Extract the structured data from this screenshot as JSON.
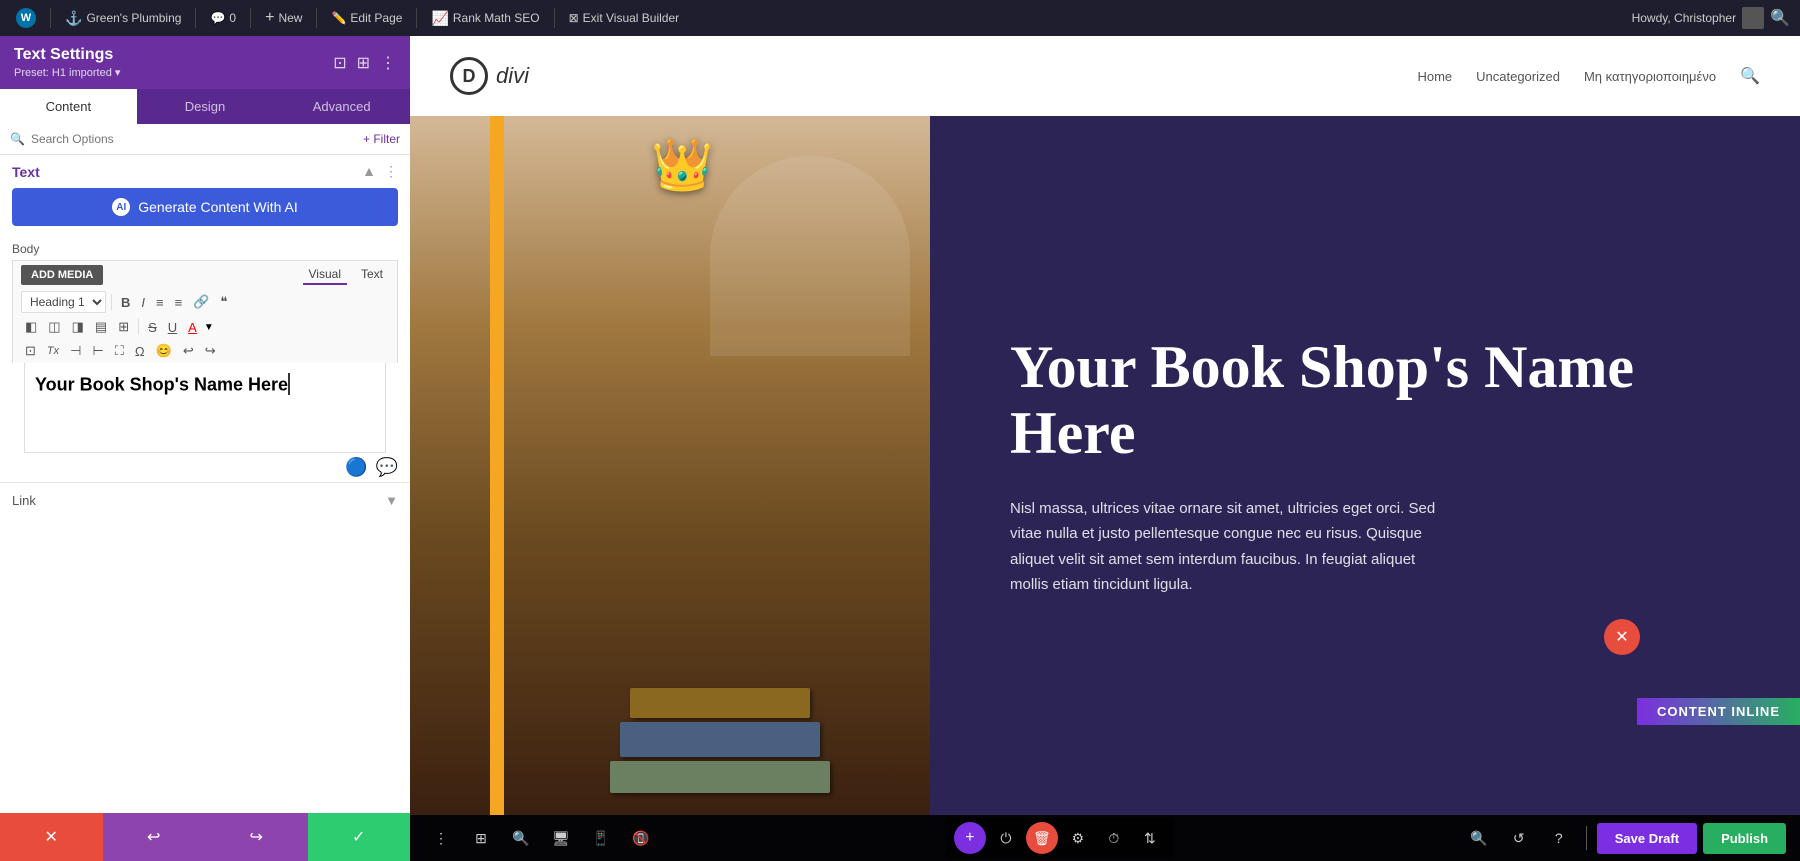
{
  "topbar": {
    "wp_icon": "W",
    "site_name": "Green's Plumbing",
    "comments_count": "0",
    "new_label": "New",
    "edit_page_label": "Edit Page",
    "rank_math_label": "Rank Math SEO",
    "exit_label": "Exit Visual Builder",
    "howdy_label": "Howdy, Christopher"
  },
  "panel": {
    "title": "Text Settings",
    "preset": "Preset: H1 imported ▾",
    "tabs": [
      "Content",
      "Design",
      "Advanced"
    ],
    "active_tab": "Content",
    "search_placeholder": "Search Options",
    "filter_label": "+ Filter",
    "section_title": "Text",
    "ai_button_label": "Generate Content With AI",
    "body_label": "Body",
    "add_media_label": "ADD MEDIA",
    "editor_tab_visual": "Visual",
    "editor_tab_text": "Text",
    "heading_option": "Heading 1",
    "text_content": "Your Book Shop's Name Here",
    "link_label": "Link",
    "bottom_actions": {
      "cancel": "✕",
      "undo": "↩",
      "redo": "↪",
      "confirm": "✓"
    }
  },
  "site": {
    "logo_letter": "D",
    "logo_name": "divi",
    "nav_links": [
      "Home",
      "Uncategorized",
      "Μη κατηγοριοποιημένο"
    ],
    "hero_title": "Your Book Shop's Name Here",
    "hero_body": "Nisl massa, ultrices vitae ornare sit amet, ultricies eget orci. Sed vitae nulla et justo pellentesque congue nec eu risus. Quisque aliquet velit sit amet sem interdum faucibus. In feugiat aliquet mollis etiam tincidunt ligula."
  },
  "builder": {
    "save_draft_label": "Save Draft",
    "publish_label": "Publish"
  },
  "icons": {
    "wp": "W",
    "bubble": "💬",
    "plus": "+",
    "pencil": "✏",
    "chart": "📊",
    "exit": "⊠",
    "search": "🔍",
    "collapse": "⊟",
    "more": "⋮",
    "chevron_up": "▲",
    "chevron_down": "▼",
    "ai": "AI",
    "bold": "B",
    "italic": "I",
    "ul": "≡",
    "ol": "≡",
    "link": "🔗",
    "quote": "❝",
    "align_left": "⬛",
    "strikethrough": "S̶",
    "underline": "U",
    "color": "A",
    "undo_editor": "↩",
    "redo_editor": "↪",
    "green_dot": "🟢",
    "chat": "💬"
  }
}
